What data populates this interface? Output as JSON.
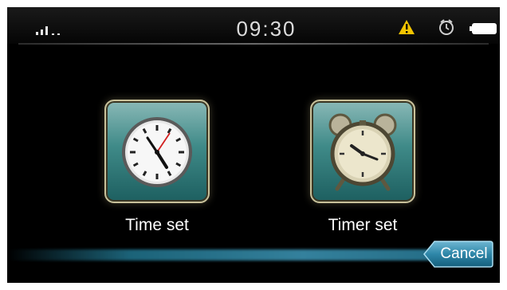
{
  "status_bar": {
    "time": "09:30",
    "signal_icon": "signal-strength-icon",
    "warning_icon": "warning-icon",
    "alarm_icon": "alarm-clock-icon",
    "battery_icon": "battery-icon"
  },
  "apps": [
    {
      "label": "Time set",
      "icon": "clock-icon"
    },
    {
      "label": "Timer set",
      "icon": "alarm-clock-icon"
    }
  ],
  "cancel_label": "Cancel",
  "colors": {
    "background": "#000000",
    "tile_teal": "#3f8a88",
    "tile_border": "#c9c19a",
    "accent_blue": "#2b7c98",
    "warning_yellow": "#f2c400"
  }
}
